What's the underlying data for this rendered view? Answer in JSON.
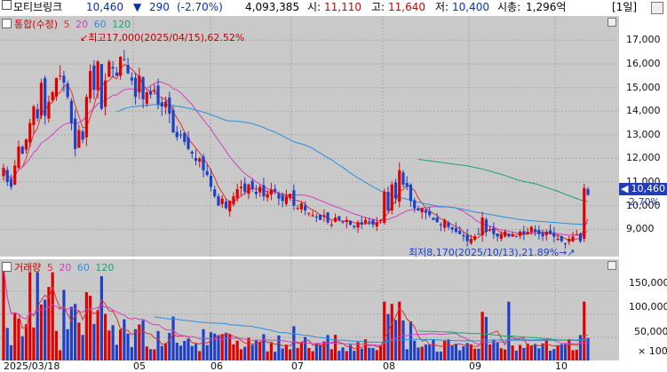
{
  "header": {
    "stock_name": "모티브링크",
    "price": "10,460",
    "arrow": "▼",
    "change": "290",
    "change_pct": "(-2.70%)",
    "volume": "4,093,385",
    "open_label": "시:",
    "open": "11,110",
    "high_label": "고:",
    "high": "11,640",
    "low_label": "저:",
    "low": "10,400",
    "mcap_label": "시총:",
    "mcap": "1,296억",
    "period": "[1일]"
  },
  "price_legend": {
    "title": "통합(수정)",
    "ma": [
      "5",
      "20",
      "60",
      "120"
    ]
  },
  "volume_legend": {
    "title": "거래량",
    "ma": [
      "5",
      "20",
      "60",
      "120"
    ]
  },
  "price_axis": {
    "ticks": [
      "17,000",
      "16,000",
      "15,000",
      "14,000",
      "13,000",
      "12,000",
      "11,000",
      "10,000",
      "9,000"
    ],
    "current_price": "10,460",
    "current_pct": "-2.70%"
  },
  "volume_axis": {
    "ticks": [
      "150,000",
      "100,000",
      "50,000",
      "× 100"
    ]
  },
  "date_axis": {
    "labels": [
      "2025/03/18",
      "05",
      "06",
      "07",
      "08",
      "09",
      "10"
    ]
  },
  "annotations": {
    "high": "최고17,000(2025/04/15),62.52%",
    "low": "최저8,170(2025/10/13),21.89%"
  },
  "colors": {
    "up": "#e00000",
    "down": "#1e40c8",
    "ma5": "#e03030",
    "ma20": "#d040c0",
    "ma60": "#2a8fe0",
    "ma120": "#20a070",
    "panel_bg": "#c9c9c9"
  },
  "chart_data": {
    "type": "candlestick",
    "y_range": [
      8000,
      17800
    ],
    "candles_close": [
      11600,
      11000,
      10800,
      11700,
      12500,
      12200,
      12800,
      13500,
      14200,
      13700,
      15200,
      13800,
      14400,
      14800,
      15400,
      15500,
      15200,
      14600,
      13500,
      12400,
      13200,
      12800,
      14600,
      15700,
      14900,
      16100,
      14100,
      15300,
      16100,
      15800,
      15500,
      16300,
      16200,
      15600,
      15300,
      14600,
      15500,
      14500,
      14800,
      14700,
      14900,
      14300,
      14200,
      14400,
      13900,
      13100,
      12900,
      13000,
      12700,
      12400,
      12200,
      11900,
      12000,
      11500,
      11300,
      10800,
      10400,
      10000,
      10300,
      9900,
      10200,
      10400,
      10700,
      10800,
      10600,
      10900,
      10700,
      10500,
      10800,
      10400,
      10500,
      10700,
      10600,
      10300,
      10200,
      10400,
      10500,
      10000,
      9900,
      10100,
      9800,
      9700,
      9600,
      9500,
      9400,
      9600,
      9300,
      9200,
      9500,
      9400,
      9300,
      9400,
      9200,
      9100,
      9300,
      9200,
      9400,
      9300,
      9200,
      9300,
      9400,
      10600,
      9800,
      10900,
      10300,
      11500,
      10900,
      10800,
      10200,
      9900,
      9800,
      9900,
      9700,
      9600,
      9400,
      9300,
      9200,
      9400,
      9100,
      9000,
      8900,
      8800,
      8700,
      8500,
      8600,
      8700,
      8800,
      9500,
      8900,
      9000,
      8800,
      8700,
      8800,
      8900,
      8700,
      8800,
      8700,
      8900,
      8800,
      8900,
      9100,
      8900,
      8800,
      8700,
      8900,
      8800,
      8700,
      8600,
      8500,
      8400,
      8600,
      8700,
      8800,
      8500,
      10750,
      10460
    ],
    "volume_max": 160000
  }
}
